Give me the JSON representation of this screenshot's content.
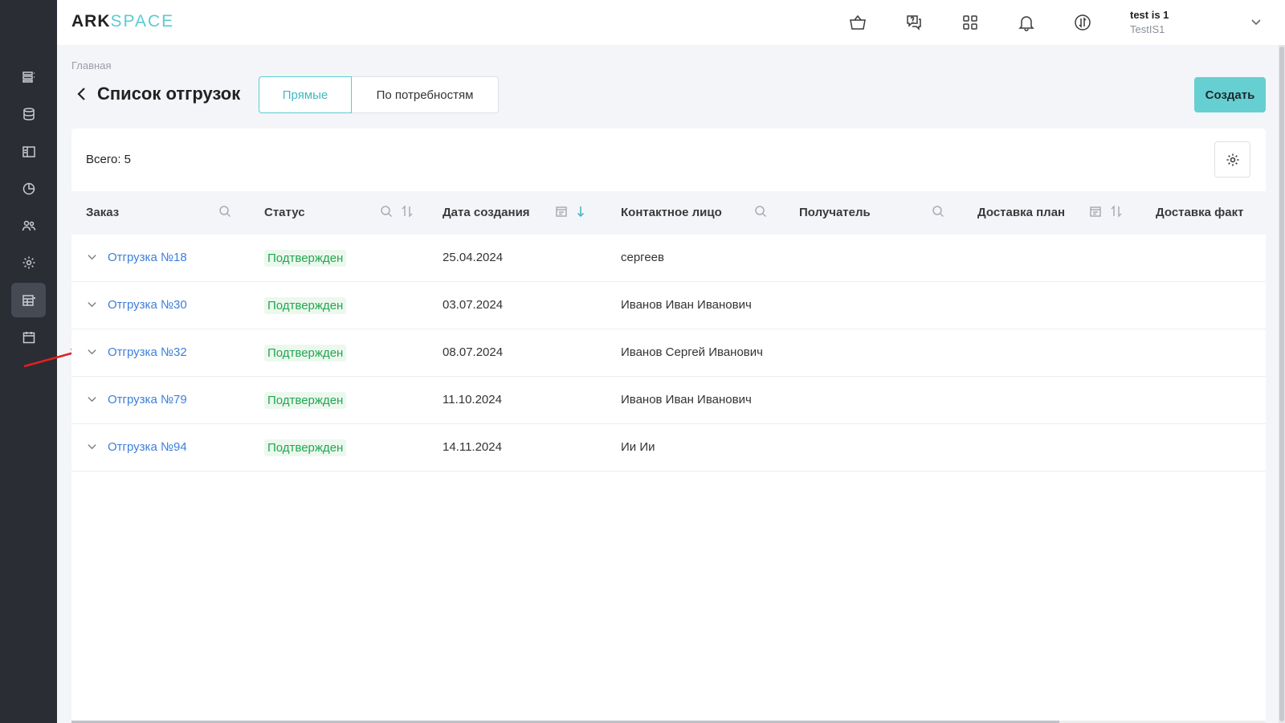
{
  "app": {
    "logo_part1": "ARK",
    "logo_part2": "SPACE",
    "user_name": "test is 1",
    "user_login": "TestIS1"
  },
  "sidebar": {
    "items": [
      {
        "icon": "list-icon"
      },
      {
        "icon": "database-icon"
      },
      {
        "icon": "layout-icon"
      },
      {
        "icon": "pie-chart-icon"
      },
      {
        "icon": "users-icon"
      },
      {
        "icon": "gear-icon"
      },
      {
        "icon": "table-grid-icon",
        "active": true
      },
      {
        "icon": "calendar-icon"
      }
    ]
  },
  "topbar": {
    "icons": [
      "basket-icon",
      "chat-help-icon",
      "apps-grid-icon",
      "bell-icon",
      "sync-icon"
    ]
  },
  "page": {
    "breadcrumb": "Главная",
    "title": "Список отгрузок",
    "tabs": [
      "Прямые",
      "По потребностям"
    ],
    "active_tab": "Прямые",
    "create_label": "Создать",
    "total_label": "Всего: 5"
  },
  "table": {
    "columns": [
      "Заказ",
      "Статус",
      "Дата создания",
      "Контактное лицо",
      "Получатель",
      "Доставка план",
      "Доставка факт"
    ],
    "rows": [
      {
        "order": "Отгрузка №18",
        "status": "Подтвержден",
        "created": "25.04.2024",
        "contact": "сергеев",
        "recipient": "",
        "plan": "",
        "fact": ""
      },
      {
        "order": "Отгрузка №30",
        "status": "Подтвержден",
        "created": "03.07.2024",
        "contact": "Иванов Иван Иванович",
        "recipient": "",
        "plan": "",
        "fact": ""
      },
      {
        "order": "Отгрузка №32",
        "status": "Подтвержден",
        "created": "08.07.2024",
        "contact": "Иванов Сергей Иванович",
        "recipient": "",
        "plan": "",
        "fact": ""
      },
      {
        "order": "Отгрузка №79",
        "status": "Подтвержден",
        "created": "11.10.2024",
        "contact": "Иванов Иван Иванович",
        "recipient": "",
        "plan": "",
        "fact": ""
      },
      {
        "order": "Отгрузка №94",
        "status": "Подтвержден",
        "created": "14.11.2024",
        "contact": "Ии Ии",
        "recipient": "",
        "plan": "",
        "fact": ""
      }
    ]
  },
  "colors": {
    "accent": "#5ccbd3",
    "link": "#3d7fd9",
    "status_green": "#22a650",
    "sidebar_bg": "#2a2d34",
    "annotation_arrow": "#e02020"
  }
}
